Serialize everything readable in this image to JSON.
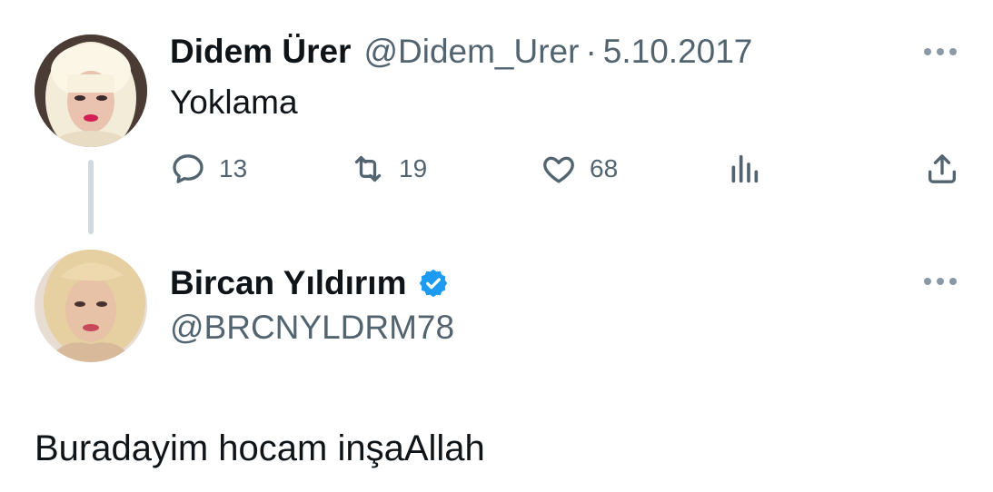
{
  "tweet_original": {
    "author_name": "Didem Ürer",
    "author_handle": "@Didem_Urer",
    "separator": "·",
    "date": "5.10.2017",
    "text": "Yoklama",
    "actions": {
      "reply_count": "13",
      "retweet_count": "19",
      "like_count": "68"
    },
    "icons": [
      "reply-icon",
      "retweet-icon",
      "like-icon",
      "views-icon",
      "share-icon",
      "more-icon"
    ]
  },
  "tweet_reply": {
    "author_name": "Bircan Yıldırım",
    "author_handle": "@BRCNYLDRM78",
    "verified": true,
    "text": "Buradayim hocam inşaAllah",
    "icons": [
      "verified-badge-icon",
      "more-icon"
    ]
  },
  "colors": {
    "text_primary": "#0f1419",
    "text_secondary": "#536471",
    "verified_blue": "#1d9bf0",
    "thread_line": "#cfd9de",
    "background": "#ffffff"
  }
}
